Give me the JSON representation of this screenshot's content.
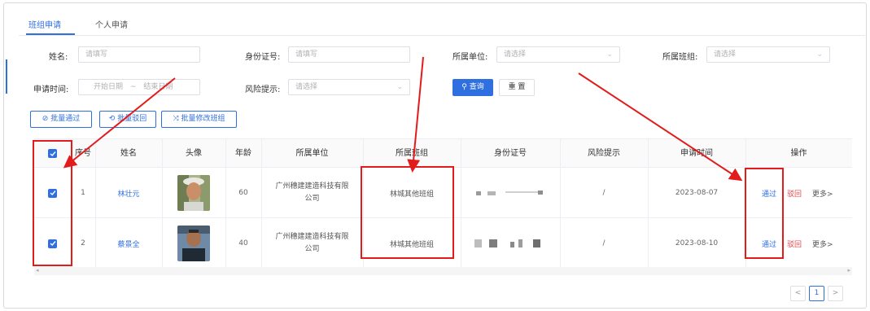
{
  "tabs": [
    {
      "label": "班组申请",
      "active": true
    },
    {
      "label": "个人申请",
      "active": false
    }
  ],
  "filters": {
    "name": {
      "label": "姓名:",
      "placeholder": "请填写"
    },
    "id_number": {
      "label": "身份证号:",
      "placeholder": "请填写"
    },
    "unit": {
      "label": "所属单位:",
      "placeholder": "请选择"
    },
    "team": {
      "label": "所属班组:",
      "placeholder": "请选择"
    },
    "apply_time": {
      "label": "申请时间:",
      "start_placeholder": "开始日期",
      "separator": "~",
      "end_placeholder": "结束日期"
    },
    "risk": {
      "label": "风险提示:",
      "placeholder": "请选择"
    },
    "search_label": "查询",
    "reset_label": "重 置"
  },
  "batch_actions": {
    "approve": "批量通过",
    "reject": "批量驳回",
    "change_team": "批量修改班组"
  },
  "table": {
    "columns": [
      "序号",
      "姓名",
      "头像",
      "年龄",
      "所属单位",
      "所属班组",
      "身份证号",
      "风险提示",
      "申请时间",
      "操作"
    ],
    "rows": [
      {
        "index": "1",
        "name": "林壮元",
        "age": "60",
        "unit_line1": "广州穗建建造科技有限",
        "unit_line2": "公司",
        "team": "林城其他班组",
        "risk": "/",
        "time": "2023-08-07",
        "checked": true
      },
      {
        "index": "2",
        "name": "蔡景全",
        "age": "40",
        "unit_line1": "广州穗建建造科技有限",
        "unit_line2": "公司",
        "team": "林城其他班组",
        "risk": "/",
        "time": "2023-08-10",
        "checked": true
      }
    ],
    "actions": {
      "approve": "通过",
      "reject": "驳回",
      "more": "更多>"
    }
  },
  "pagination": {
    "prev": "<",
    "current": "1",
    "next": ">"
  },
  "colors": {
    "primary": "#2f6fe0",
    "danger": "#e0484e",
    "annotation_red": "#e21b1b"
  }
}
